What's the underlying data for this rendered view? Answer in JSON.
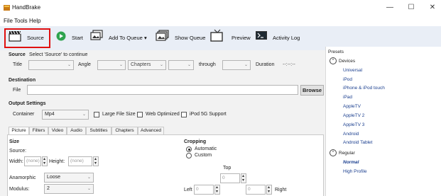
{
  "window": {
    "title": "HandBrake",
    "minimize": "—",
    "maximize": "☐",
    "close": "✕"
  },
  "menu": [
    "File",
    "Tools",
    "Help"
  ],
  "toolbar": {
    "source": "Source",
    "start": "Start",
    "add_to_queue": "Add To Queue",
    "add_to_queue_arrow": "▾",
    "show_queue": "Show Queue",
    "preview": "Preview",
    "activity_log": "Activity Log"
  },
  "source": {
    "heading": "Source",
    "hint": "Select 'Source' to continue",
    "title_label": "Title",
    "angle_label": "Angle",
    "chapters_value": "Chapters",
    "through_label": "through",
    "duration_label": "Duration",
    "duration_value": "--:--:--"
  },
  "destination": {
    "heading": "Destination",
    "file_label": "File",
    "file_value": "",
    "browse": "Browse"
  },
  "output": {
    "heading": "Output Settings",
    "container_label": "Container",
    "container_value": "Mp4",
    "large_file": "Large File Size",
    "web_optimized": "Web Optimized",
    "ipod": "iPod 5G Support"
  },
  "tabs": [
    "Picture",
    "Filters",
    "Video",
    "Audio",
    "Subtitles",
    "Chapters",
    "Advanced"
  ],
  "picture": {
    "size_heading": "Size",
    "source_label": "Source:",
    "width_label": "Width:",
    "width_value": "(none)",
    "height_label": "Height:",
    "height_value": "(none)",
    "anamorphic_label": "Anamorphic",
    "anamorphic_value": "Loose",
    "modulus_label": "Modulus:",
    "modulus_value": "2",
    "cropping_heading": "Cropping",
    "automatic": "Automatic",
    "custom": "Custom",
    "top_label": "Top",
    "top_value": "0",
    "left_label": "Left",
    "left_value": "0",
    "right_value": "0",
    "right_label": "Right"
  },
  "presets": {
    "heading": "Presets",
    "devices_group": "Devices",
    "devices": [
      "Universal",
      "iPod",
      "iPhone & iPod touch",
      "iPad",
      "AppleTV",
      "AppleTV 2",
      "AppleTV 3",
      "Android",
      "Android Tablet"
    ],
    "regular_group": "Regular",
    "regular": [
      "Normal",
      "High Profile"
    ],
    "collapse_glyph": "^"
  },
  "colors": {
    "source_highlight": "#e01010",
    "toolbar_bg": "#e9eef6",
    "preset_link": "#1b3f8f",
    "start_green": "#2fa44f"
  }
}
